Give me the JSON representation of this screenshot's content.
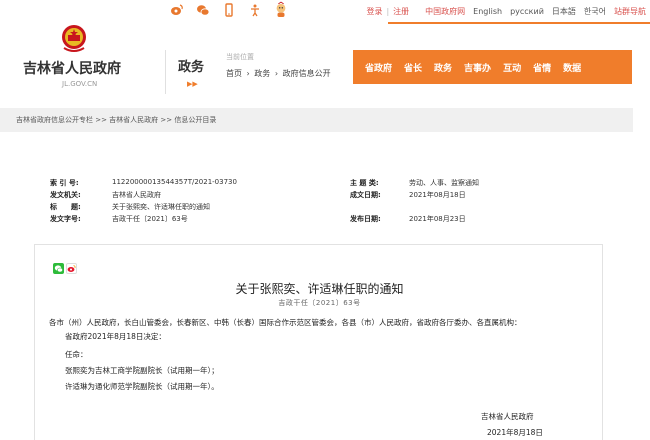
{
  "topbar": {
    "login": "登录",
    "divider": "|",
    "register": "注册",
    "languages": [
      "中国政府网",
      "English",
      "русский",
      "日本語",
      "한국어",
      "站群导航"
    ]
  },
  "header": {
    "site_title": "吉林省人民政府",
    "site_domain": "JL.GOV.CN",
    "channel": "政务",
    "channel_arrows": "▶▶",
    "crumb_label": "当前位置",
    "crumb_items": [
      "首页",
      "›",
      "政务",
      "›",
      "政府信息公开"
    ]
  },
  "mainnav": [
    "省政府",
    "省长",
    "政务",
    "吉事办",
    "互动",
    "省情",
    "数据"
  ],
  "strip": {
    "path": "吉林省政府信息公开专栏  >>  吉林省人民政府  >>  信息公开目录"
  },
  "meta": {
    "index_label": "索 引 号:",
    "index_value": "11220000013544357T/2021-03730",
    "org_label": "发文机关:",
    "org_value": "吉林省人民政府",
    "title_label": "标　　题:",
    "title_value": "关于张熙奕、许适琳任职的通知",
    "docno_label": "发文字号:",
    "docno_value": "吉政干任〔2021〕63号",
    "category_label": "主 题 类:",
    "category_value": "劳动、人事、监察通知",
    "written_label": "成文日期:",
    "written_value": "2021年08月18日",
    "published_label": "发布日期:",
    "published_value": "2021年08月23日"
  },
  "doc": {
    "title": "关于张熙奕、许适琳任职的通知",
    "number": "吉政干任〔2021〕63号",
    "addressee": "各市（州）人民政府，长白山管委会，长春新区、中韩（长春）国际合作示范区管委会，各县（市）人民政府，省政府各厅委办、各直属机构：",
    "line1": "省政府2021年8月18日决定：",
    "line2": "任命：",
    "line3": "张熙奕为吉林工商学院副院长（试用期一年）；",
    "line4": "许适琳为通化师范学院副院长（试用期一年）。",
    "signer": "吉林省人民政府",
    "sign_date": "2021年8月18日"
  },
  "colors": {
    "accent": "#f07d2b",
    "emblem": "#c8161d"
  },
  "icons": [
    "weibo-icon",
    "wechat-icon",
    "mobile-icon",
    "accessibility-icon",
    "mascot-icon",
    "wechat-share-icon",
    "weibo-share-icon"
  ]
}
